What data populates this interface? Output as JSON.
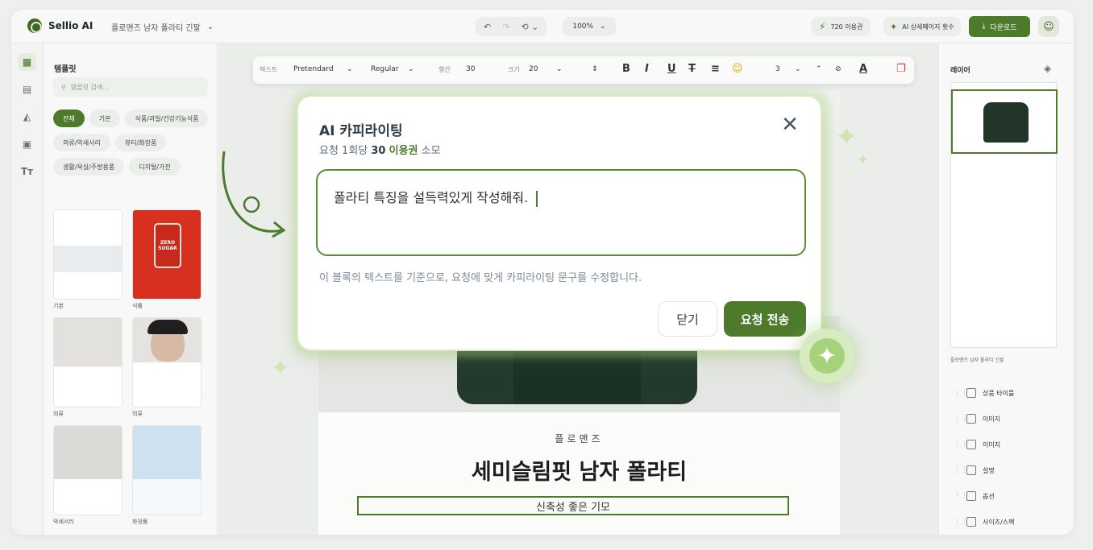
{
  "app": {
    "name": "Sellio AI",
    "doc_title": "플로맨즈 남자 폴라티 긴팔"
  },
  "topbar": {
    "zoom": "100%",
    "credits": "720 이용권",
    "ai_count": "AI 상세페이지 횟수",
    "download": "다운로드"
  },
  "template_panel": {
    "title": "템플릿",
    "search_placeholder": "템플릿 검색...",
    "chips": [
      "전체",
      "기본",
      "식품/과일/건강기능식품",
      "의류/악세사리",
      "뷰티/화장품",
      "생활/욕실/주방용품",
      "디지털/가전"
    ],
    "thumbs": [
      {
        "label": "기본"
      },
      {
        "label": "식품",
        "can_text": "ZERO SUGAR"
      },
      {
        "label": "의류"
      },
      {
        "label": "의류"
      },
      {
        "label": "악세서리"
      },
      {
        "label": "화장품"
      }
    ]
  },
  "text_toolbar": {
    "type_label": "텍스트",
    "font": "Pretendard",
    "weight": "Regular",
    "line_label": "행간",
    "line_value": "30",
    "size_label": "크기",
    "size_value": "20",
    "number": "3"
  },
  "page": {
    "brand": "플로맨즈",
    "title": "세미슬림핏 남자 폴라티",
    "subtitle": "신축성 좋은 기모"
  },
  "dialog": {
    "title": "AI 카피라이팅",
    "cost_prefix": "요청 1회당 ",
    "cost_num": "30",
    "cost_unit": "이용권",
    "cost_suffix": " 소모",
    "input_value": "폴라티 특징을 설득력있게 작성해줘.",
    "help": "이 블록의 텍스트를 기준으로, 요청에 맞게 카피라이팅 문구를 수정합니다.",
    "cancel": "닫기",
    "send": "요청 전송"
  },
  "right_panel": {
    "title": "레이어",
    "preview_caption": "플로맨즈 남자 폴라티 긴팔",
    "layers": [
      "상품 타이틀",
      "이미지",
      "이미지",
      "설명",
      "옵션",
      "사이즈/스펙"
    ]
  },
  "colors": {
    "accent": "#4e7a2c",
    "accent_light": "#d6ebbf"
  }
}
